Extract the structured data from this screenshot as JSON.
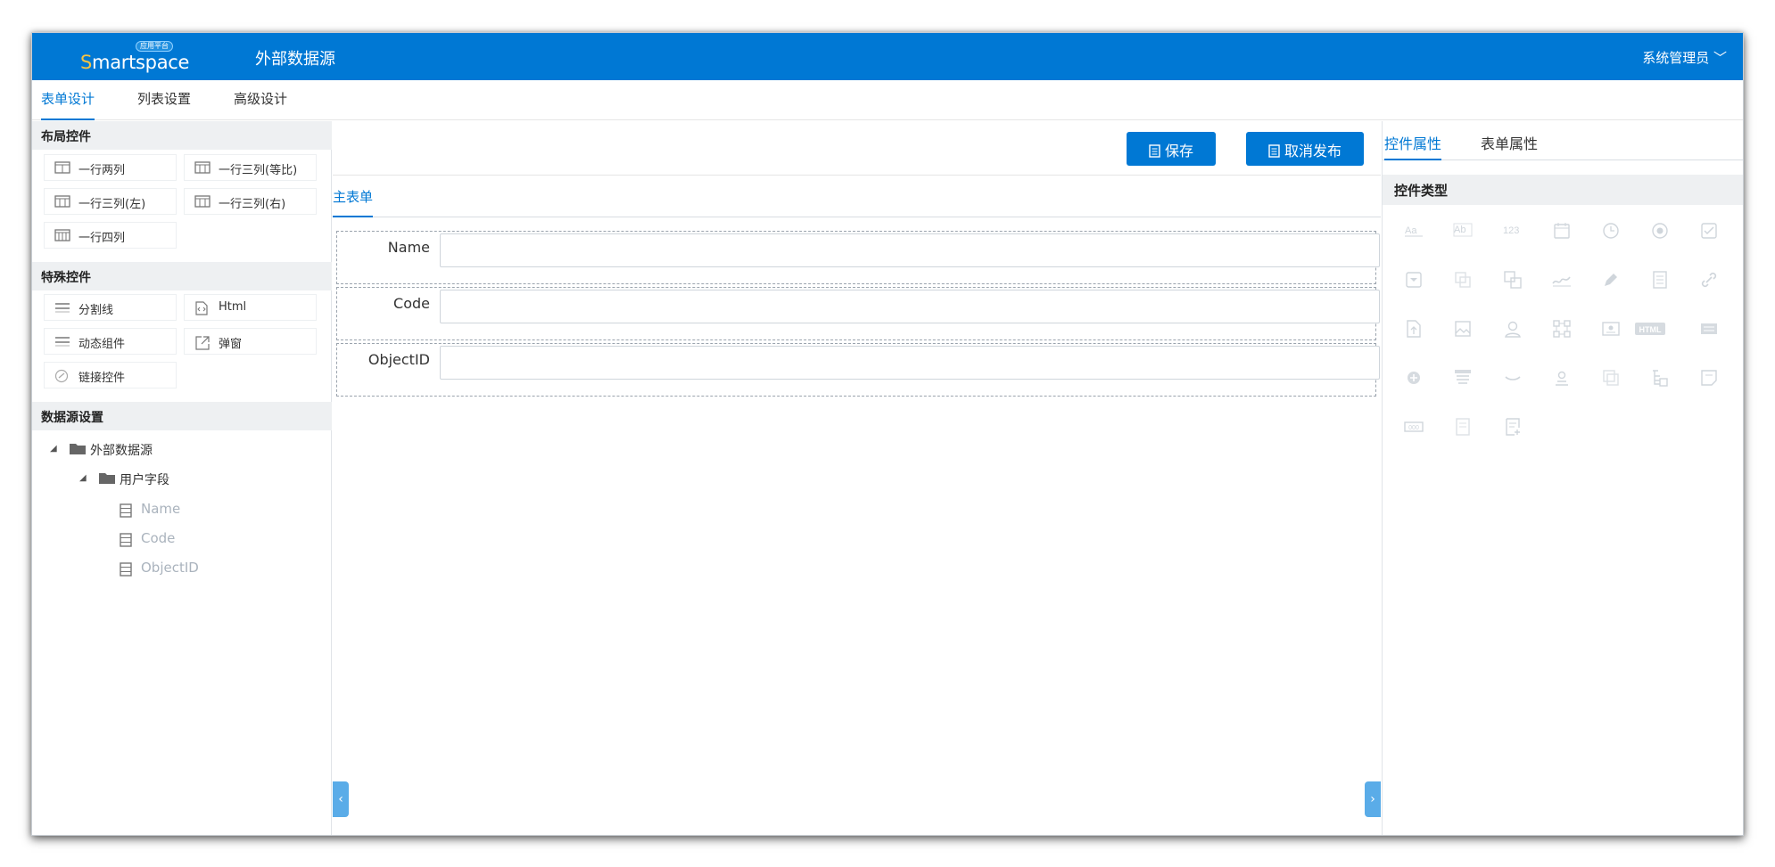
{
  "header": {
    "logo_badge": "应用平台",
    "logo_first": "S",
    "logo_rest": "martspace",
    "title": "外部数据源",
    "user": "系统管理员"
  },
  "top_tabs": [
    "表单设计",
    "列表设置",
    "高级设计"
  ],
  "left": {
    "layout_title": "布局控件",
    "layout_controls": [
      "一行两列",
      "一行三列(等比)",
      "一行三列(左)",
      "一行三列(右)",
      "一行四列"
    ],
    "special_title": "特殊控件",
    "special_controls": [
      "分割线",
      "Html",
      "动态组件",
      "弹窗",
      "链接控件"
    ],
    "datasource_title": "数据源设置",
    "tree": {
      "root": "外部数据源",
      "group": "用户字段",
      "fields": [
        "Name",
        "Code",
        "ObjectID"
      ]
    }
  },
  "toolbar": {
    "save_label": "保存",
    "unpublish_label": "取消发布"
  },
  "form": {
    "tab": "主表单",
    "fields": [
      {
        "label": "Name",
        "value": ""
      },
      {
        "label": "Code",
        "value": ""
      },
      {
        "label": "ObjectID",
        "value": ""
      }
    ]
  },
  "right": {
    "tabs": [
      "控件属性",
      "表单属性"
    ],
    "section_title": "控件类型",
    "control_icons": [
      "single-line-text-icon",
      "multi-line-text-icon",
      "number-icon",
      "date-icon",
      "time-icon",
      "radio-icon",
      "checkbox-icon",
      "dropdown-icon",
      "multi-select-icon",
      "relation-icon",
      "signature-icon",
      "pen-icon",
      "attachment-list-icon",
      "link-icon",
      "upload-icon",
      "image-icon",
      "user-icon",
      "org-icon",
      "id-card-icon",
      "html-icon",
      "form-icon",
      "add-circle-icon",
      "table-icon",
      "divider-icon",
      "location-icon",
      "copy-icon",
      "tree-icon",
      "note-icon",
      "serial-number-icon",
      "document-icon",
      "child-form-icon"
    ],
    "html_icon_text": "HTML",
    "number_icon_text": "123"
  },
  "colors": {
    "primary": "#0078d4",
    "logo_accent": "#f6c343",
    "icon_gray": "#cfd5db"
  }
}
